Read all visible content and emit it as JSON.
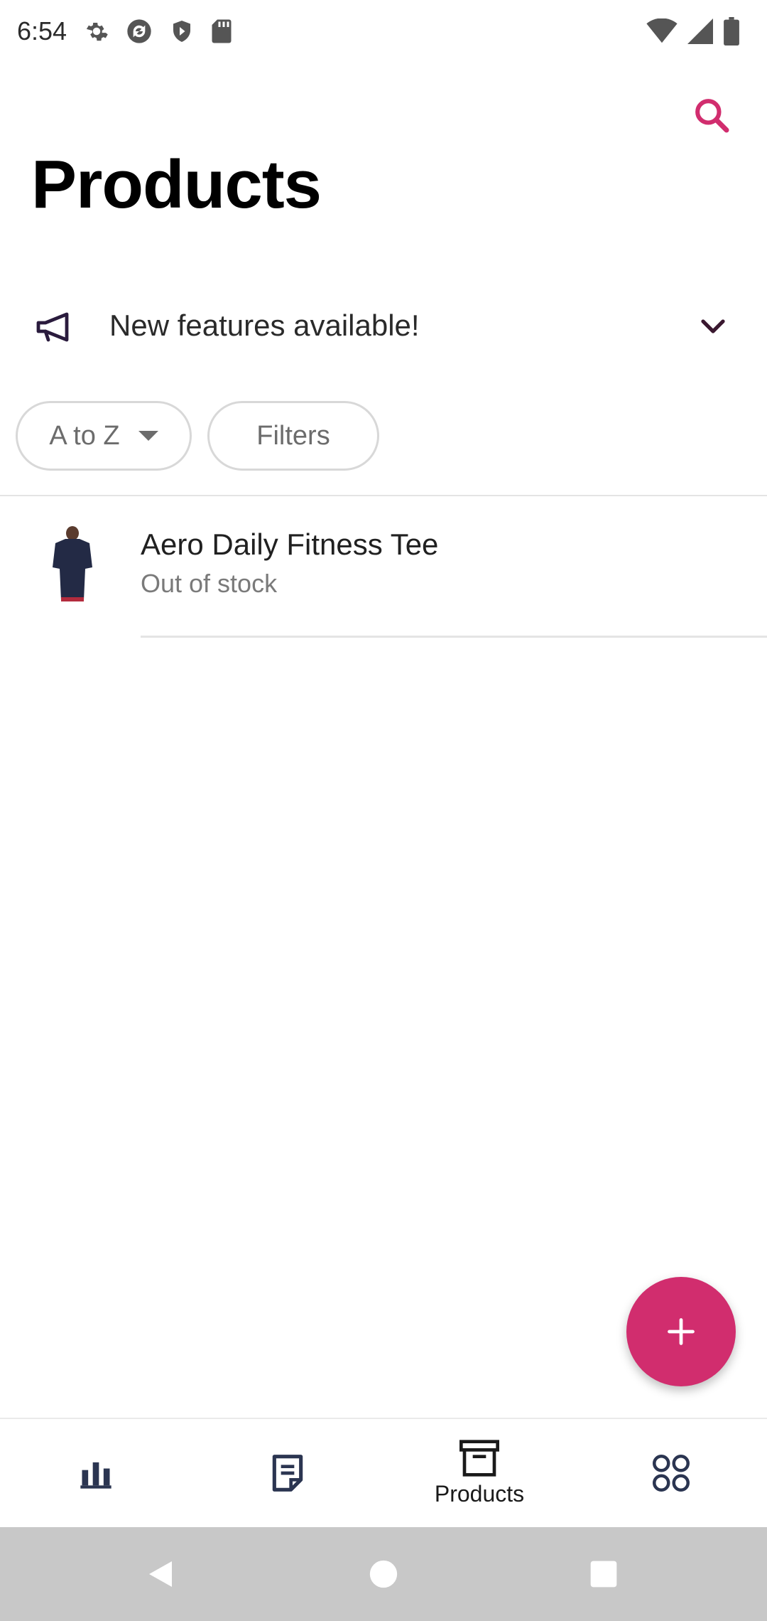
{
  "status_bar": {
    "time": "6:54",
    "left_icons": [
      "settings-icon",
      "sync-icon",
      "shield-play-icon",
      "sd-card-icon"
    ],
    "right_icons": [
      "wifi-icon",
      "signal-icon",
      "battery-icon"
    ]
  },
  "header": {
    "title": "Products",
    "search_icon": "search-icon"
  },
  "banner": {
    "icon": "megaphone-icon",
    "text": "New features available!",
    "chevron": "chevron-down-icon"
  },
  "chips": {
    "sort_label": "A to Z",
    "filter_label": "Filters"
  },
  "products": [
    {
      "name": "Aero Daily Fitness Tee",
      "status": "Out of stock"
    }
  ],
  "fab": {
    "icon": "plus-icon"
  },
  "bottom_nav": {
    "items": [
      {
        "icon": "stats-icon",
        "label": ""
      },
      {
        "icon": "orders-icon",
        "label": ""
      },
      {
        "icon": "products-box-icon",
        "label": "Products"
      },
      {
        "icon": "more-menu-icon",
        "label": ""
      }
    ]
  },
  "colors": {
    "accent": "#d12d6e",
    "chip_border": "#d8d8d8",
    "banner_icon": "#2a1b3d"
  }
}
